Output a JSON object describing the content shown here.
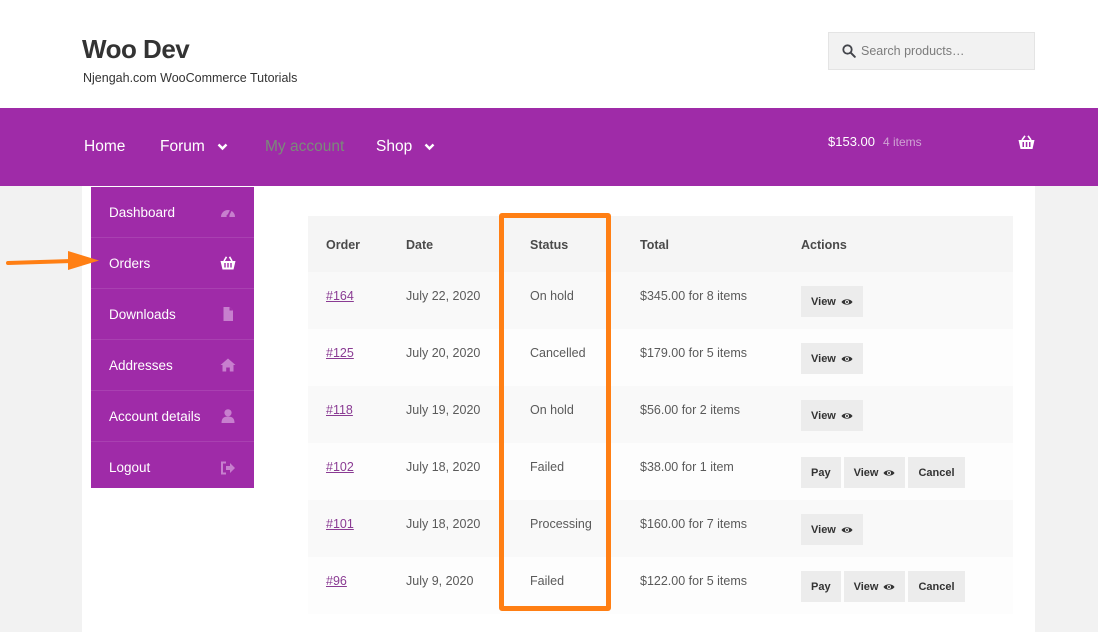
{
  "site": {
    "title": "Woo Dev",
    "tagline": "Njengah.com WooCommerce Tutorials"
  },
  "search": {
    "placeholder": "Search products…"
  },
  "nav": {
    "items": [
      {
        "label": "Home"
      },
      {
        "label": "Forum"
      },
      {
        "label": "My account"
      },
      {
        "label": "Shop"
      }
    ],
    "cart_total": "$153.00",
    "cart_count": "4 items"
  },
  "account_menu": {
    "items": [
      {
        "label": "Dashboard",
        "icon": "dashboard-icon"
      },
      {
        "label": "Orders",
        "icon": "basket-icon"
      },
      {
        "label": "Downloads",
        "icon": "file-icon"
      },
      {
        "label": "Addresses",
        "icon": "home-icon"
      },
      {
        "label": "Account details",
        "icon": "user-icon"
      },
      {
        "label": "Logout",
        "icon": "logout-icon"
      }
    ]
  },
  "orders": {
    "columns": [
      "Order",
      "Date",
      "Status",
      "Total",
      "Actions"
    ],
    "rows": [
      {
        "order": "#164",
        "date": "July 22, 2020",
        "status": "On hold",
        "total": "$345.00 for 8 items",
        "actions": [
          "View"
        ]
      },
      {
        "order": "#125",
        "date": "July 20, 2020",
        "status": "Cancelled",
        "total": "$179.00 for 5 items",
        "actions": [
          "View"
        ]
      },
      {
        "order": "#118",
        "date": "July 19, 2020",
        "status": "On hold",
        "total": "$56.00 for 2 items",
        "actions": [
          "View"
        ]
      },
      {
        "order": "#102",
        "date": "July 18, 2020",
        "status": "Failed",
        "total": "$38.00 for 1 item",
        "actions": [
          "Pay",
          "View",
          "Cancel"
        ]
      },
      {
        "order": "#101",
        "date": "July 18, 2020",
        "status": "Processing",
        "total": "$160.00 for 7 items",
        "actions": [
          "View"
        ]
      },
      {
        "order": "#96",
        "date": "July 9, 2020",
        "status": "Failed",
        "total": "$122.00 for 5 items",
        "actions": [
          "Pay",
          "View",
          "Cancel"
        ]
      }
    ]
  },
  "colors": {
    "brand_purple": "#9f2ba8",
    "annotation_orange": "#ff7f14"
  }
}
